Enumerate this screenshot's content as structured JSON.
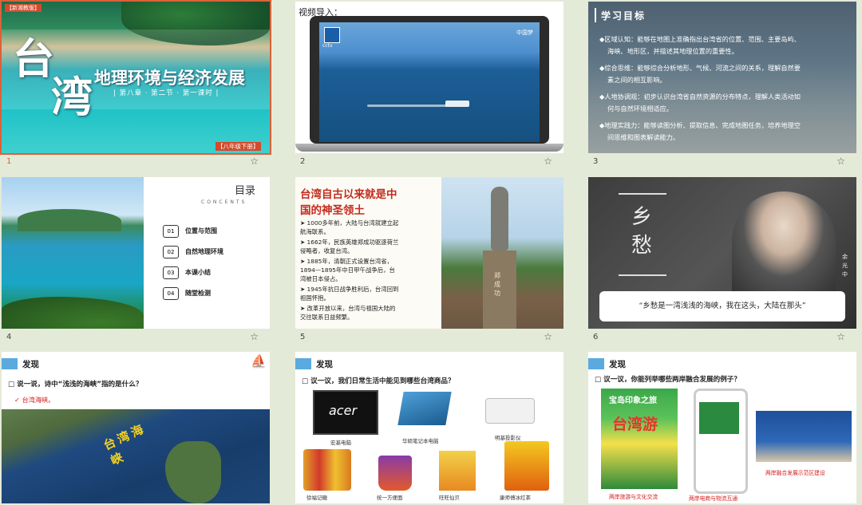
{
  "slides": [
    {
      "number": "1",
      "tag": "【新湘教版】",
      "title_big_1": "台",
      "title_big_2": "湾",
      "subtitle": "地理环境与经济发展",
      "chapter": "| 第八章 · 第二节 · 第一课时 |",
      "grade": "【八年级下册】"
    },
    {
      "number": "2",
      "heading": "视频导入：",
      "logo_left": "cctv",
      "logo_right": "中国梦"
    },
    {
      "number": "3",
      "title": "学习目标",
      "items": [
        "◆区域认知：能够在地图上准确指出台湾省的位置、范围、主要岛屿、",
        "海峡、地形区，并描述其地理位置的重要性。",
        "◆综合思维：能够综合分析地形、气候、河流之间的关系，理解自然要",
        "素之间的相互影响。",
        "◆人地协调观：初步认识台湾省自然资源的分布特点，理解人类活动如",
        "何与自然环境相适应。",
        "◆地理实践力：能够读图分析、提取信息、完成地图任务，培养地理空",
        "间思维和图表解读能力。"
      ]
    },
    {
      "number": "4",
      "toc_title": "目录",
      "toc_sub": "CONCENTS",
      "toc": [
        {
          "n": "01",
          "t": "位置与范围"
        },
        {
          "n": "02",
          "t": "自然地理环境"
        },
        {
          "n": "03",
          "t": "本课小结"
        },
        {
          "n": "04",
          "t": "随堂检测"
        }
      ]
    },
    {
      "number": "5",
      "title_1": "台湾自古以来就是中",
      "title_2": "国的神圣领土",
      "bullets": [
        "➤ 1000多年前，大陆与台湾就建立起",
        "   航海联系。",
        "➤ 1662年，民族英雄郑成功驱逐荷兰",
        "   侵略者，收复台湾。",
        "➤ 1885年，清朝正式设置台湾省，",
        "   1894—1895年中日甲午战争后，台",
        "   湾被日本侵占。",
        "➤ 1945年抗日战争胜利后，台湾回到",
        "   祖国怀抱。",
        "➤ 改革开放以来，台湾与祖国大陆的",
        "   交往联系日益频繁。"
      ],
      "statue_label": "郑成功"
    },
    {
      "number": "6",
      "calligraphy": "乡愁",
      "author": "余光中",
      "quote": "“乡愁是一湾浅浅的海峡，我在这头，大陆在那头”"
    },
    {
      "number": "7",
      "header": "发现",
      "question": "□ 说一说，诗中“浅浅的海峡”指的是什么？",
      "answer": "✓  台湾海峡。",
      "map_label": "台湾海峡"
    },
    {
      "number": "8",
      "header": "发现",
      "question": "□ 议一议，我们日常生活中能见到哪些台湾商品？",
      "products": [
        "宏基电脑",
        "华硕笔记本电脑",
        "明基投影仪",
        "徐福记糖",
        "统一方便面",
        "旺旺仙贝",
        "康师傅冰红茶"
      ],
      "brand": "acer"
    },
    {
      "number": "9",
      "header": "发现",
      "question": "□ 议一议，你能列举哪些两岸融合发展的例子？",
      "poster": "宝岛印象之旅",
      "poster_big": "台湾游",
      "captions": [
        "两岸旅游与文化交流",
        "两岸电商与物流互通",
        "两岸融合发展示范区建设"
      ]
    }
  ],
  "colors": {
    "selected_border": "#d9623a",
    "accent_blue": "#5aaae0",
    "title_red": "#c42b1c"
  }
}
